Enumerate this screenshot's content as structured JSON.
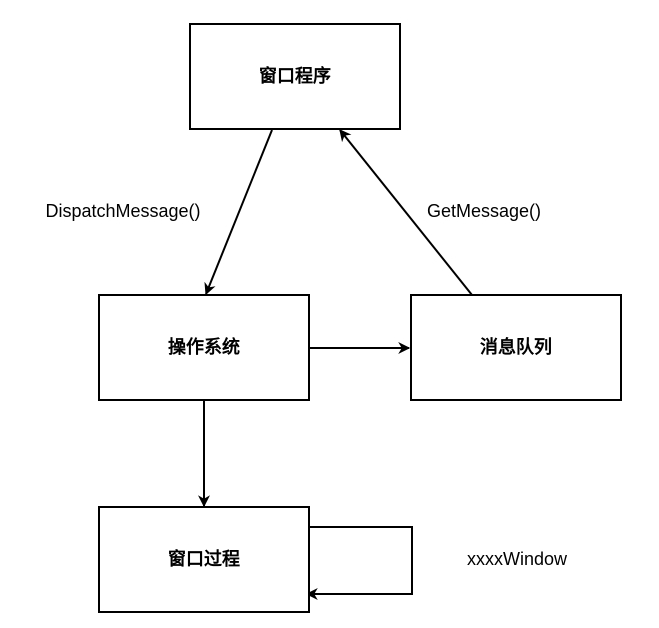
{
  "nodes": {
    "window_program": {
      "label": "窗口程序"
    },
    "operating_system": {
      "label": "操作系统"
    },
    "message_queue": {
      "label": "消息队列"
    },
    "window_procedure": {
      "label": "窗口过程"
    }
  },
  "edge_labels": {
    "dispatch": "DispatchMessage()",
    "get": "GetMessage()",
    "self_loop": "xxxxWindow"
  },
  "colors": {
    "stroke": "#000000",
    "background": "#ffffff"
  }
}
